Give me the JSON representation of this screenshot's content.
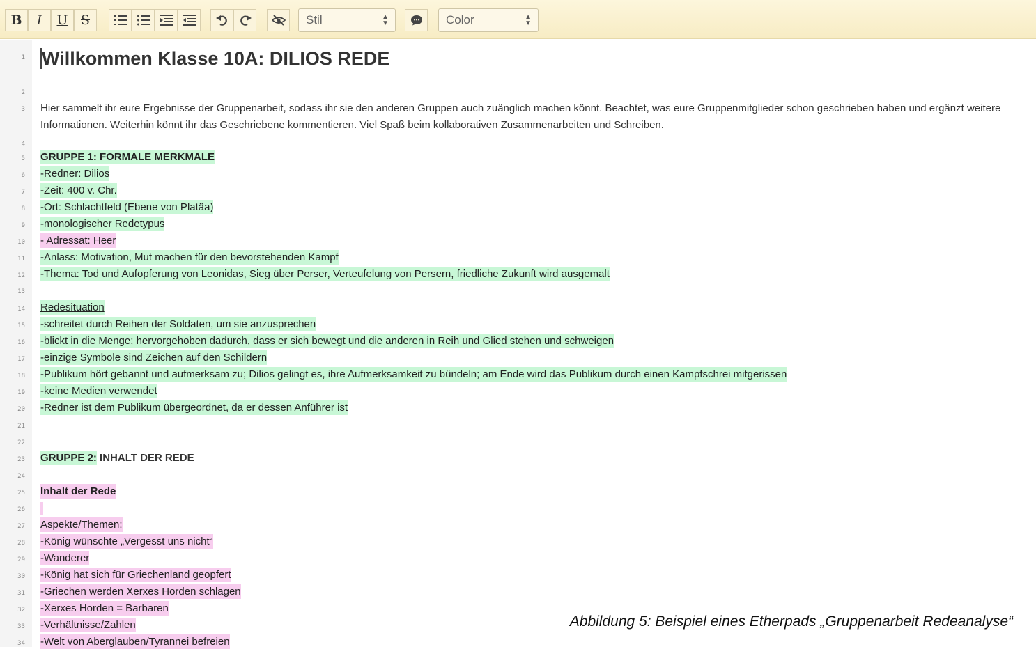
{
  "toolbar": {
    "buttons": [
      {
        "name": "bold-button",
        "glyph": "B"
      },
      {
        "name": "italic-button",
        "glyph": "I"
      },
      {
        "name": "underline-button",
        "glyph": "U"
      },
      {
        "name": "strikethrough-button",
        "glyph": "S"
      },
      {
        "name": "ordered-list-button",
        "icon": "ordered-list-icon"
      },
      {
        "name": "unordered-list-button",
        "icon": "unordered-list-icon"
      },
      {
        "name": "indent-button",
        "icon": "indent-icon"
      },
      {
        "name": "outdent-button",
        "icon": "outdent-icon"
      },
      {
        "name": "undo-button",
        "icon": "undo-icon"
      },
      {
        "name": "redo-button",
        "icon": "redo-icon"
      },
      {
        "name": "clear-authorship-button",
        "icon": "eye-slash-icon"
      },
      {
        "name": "comment-button",
        "icon": "comment-icon"
      }
    ],
    "style_select": "Stil",
    "color_select": "Color"
  },
  "colors": {
    "toolbar_bg": "#f8eec9",
    "author_green": "#c8f7d6",
    "author_pink": "#f7cdee"
  },
  "document": {
    "title": "Willkommen Klasse 10A: DILIOS REDE",
    "intro": "Hier sammelt ihr eure Ergebnisse der Gruppenarbeit, sodass ihr sie den anderen Gruppen auch zuänglich machen könnt. Beachtet, was eure Gruppenmitglieder schon geschrieben haben und ergänzt weitere Informationen. Weiterhin könnt ihr das Geschriebene kommentieren. Viel Spaß beim kollaborativen Zusammenarbeiten und Schreiben.",
    "group1_heading": "GRUPPE 1: FORMALE MERKMALE",
    "group1_items": [
      "-Redner: Dilios",
      "-Zeit: 400 v. Chr.",
      "-Ort: Schlachtfeld (Ebene von Platäa)",
      "-monologischer Redetypus",
      "- Adressat: Heer",
      "-Anlass: Motivation, Mut machen für den bevorstehenden Kampf",
      "-Thema: Tod und Aufopferung von Leonidas, Sieg über Perser, Verteufelung von Persern, friedliche Zukunft wird ausgemalt"
    ],
    "redesituation_heading": "Redesituation",
    "redesituation_items": [
      "-schreitet durch Reihen der Soldaten, um sie anzusprechen",
      "-blickt in die Menge; hervorgehoben dadurch, dass er sich bewegt und die anderen in Reih und Glied stehen und schweigen",
      "-einzige Symbole sind Zeichen auf den Schildern",
      "-Publikum hört gebannt und aufmerksam zu; Dilios gelingt es, ihre Aufmerksamkeit zu bündeln; am Ende wird das Publikum durch einen Kampfschrei mitgerissen",
      "-keine Medien verwendet",
      "-Redner ist dem Publikum übergeordnet, da er dessen Anführer ist"
    ],
    "group2_label": "GRUPPE 2:",
    "group2_rest": " INHALT DER REDE",
    "inhalt_heading": "Inhalt der Rede",
    "aspekte_label": "Aspekte/Themen:",
    "aspekte_items": [
      "-König wünschte „Vergesst uns nicht“",
      "-Wanderer",
      "-König hat sich für Griechenland geopfert",
      "-Griechen werden Xerxes Horden schlagen",
      "-Xerxes Horden = Barbaren",
      "-Verhältnisse/Zahlen",
      "-Welt von Aberglauben/Tyrannei befreien"
    ]
  },
  "line_numbers": [
    "1",
    "2",
    "3",
    "4",
    "5",
    "6",
    "7",
    "8",
    "9",
    "10",
    "11",
    "12",
    "13",
    "14",
    "15",
    "16",
    "17",
    "18",
    "19",
    "20",
    "21",
    "22",
    "23",
    "24",
    "25",
    "26",
    "27",
    "28",
    "29",
    "30",
    "31",
    "32",
    "33",
    "34"
  ],
  "caption": "Abbildung 5: Beispiel eines Etherpads „Gruppenarbeit Redeanalyse“"
}
